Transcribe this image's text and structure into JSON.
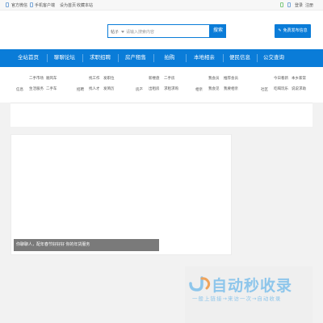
{
  "topbar": {
    "left_links": [
      "官方微信",
      "手机客户端",
      "设为首页",
      "收藏本站"
    ],
    "right_links": [
      "登录",
      "注册"
    ]
  },
  "search": {
    "category": "帖子",
    "placeholder": "请输入搜索内容",
    "button": "搜索"
  },
  "post_button": "免费发布信息",
  "nav": {
    "items": [
      "全站首页",
      "聊聊论坛",
      "求职招聘",
      "房产租售",
      "拍购",
      "本地相亲",
      "便民信息",
      "公交查询"
    ]
  },
  "subnav": {
    "groups": [
      {
        "category": "信息",
        "links": [
          "二手市场",
          "顺风车",
          "生活服务",
          "二手车"
        ]
      },
      {
        "category": "招聘",
        "links": [
          "找工作",
          "发职位",
          "找人才",
          "发简历"
        ]
      },
      {
        "category": "房产",
        "links": [
          "新楼盘",
          "二手房",
          "出租房",
          "求租求购"
        ]
      },
      {
        "category": "相亲",
        "links": [
          "我会员",
          "推荐会员",
          "我会见",
          "我要相亲"
        ]
      },
      {
        "category": "社区",
        "links": [
          "今日看新",
          "本乡家常",
          "吃喝玩乐",
          "说说求助"
        ]
      }
    ]
  },
  "banner": {
    "caption": "你聊聊人，配年春节好好好 你的年货服务"
  },
  "watermark": {
    "title": "自动秒收录",
    "subtitle": "一般上链接→来访一次→自动收录"
  },
  "colors": {
    "primary": "#0a7cd8",
    "watermark": "#8ec6eb"
  }
}
